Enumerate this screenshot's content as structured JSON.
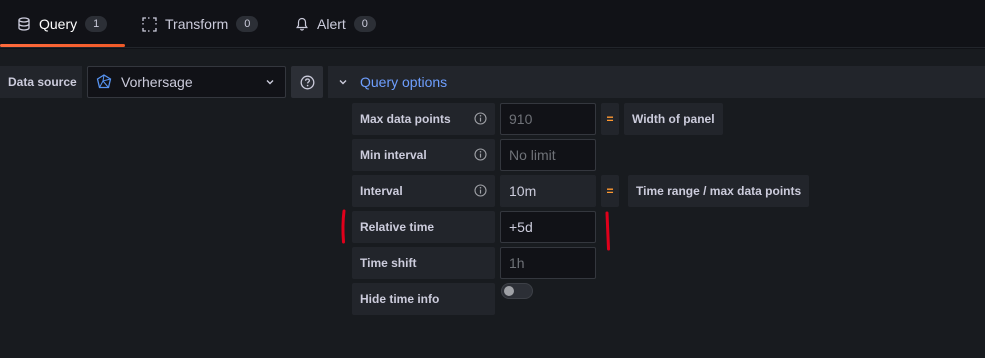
{
  "tabs": [
    {
      "label": "Query",
      "count": "1",
      "icon": "database-icon",
      "active": true
    },
    {
      "label": "Transform",
      "count": "0",
      "icon": "transform-icon",
      "active": false
    },
    {
      "label": "Alert",
      "count": "0",
      "icon": "bell-icon",
      "active": false
    }
  ],
  "datasource": {
    "label": "Data source",
    "selected": "Vorhersage",
    "icon": "datasource-icon"
  },
  "query_options": {
    "title": "Query options",
    "rows": [
      {
        "label": "Max data points",
        "value": "",
        "placeholder": "910",
        "equals": "=",
        "equals_text": "Width of panel"
      },
      {
        "label": "Min interval",
        "value": "",
        "placeholder": "No limit"
      },
      {
        "label": "Interval",
        "value": "10m",
        "placeholder": "",
        "equals": "=",
        "equals_text": "Time range / max data points"
      },
      {
        "label": "Relative time",
        "value": "+5d",
        "placeholder": ""
      },
      {
        "label": "Time shift",
        "value": "",
        "placeholder": "1h"
      },
      {
        "label": "Hide time info",
        "toggle": false
      }
    ]
  },
  "colors": {
    "accent": "#f05a28",
    "link": "#6e9fff",
    "equals": "#ff9830",
    "annotation": "#e0001b"
  }
}
